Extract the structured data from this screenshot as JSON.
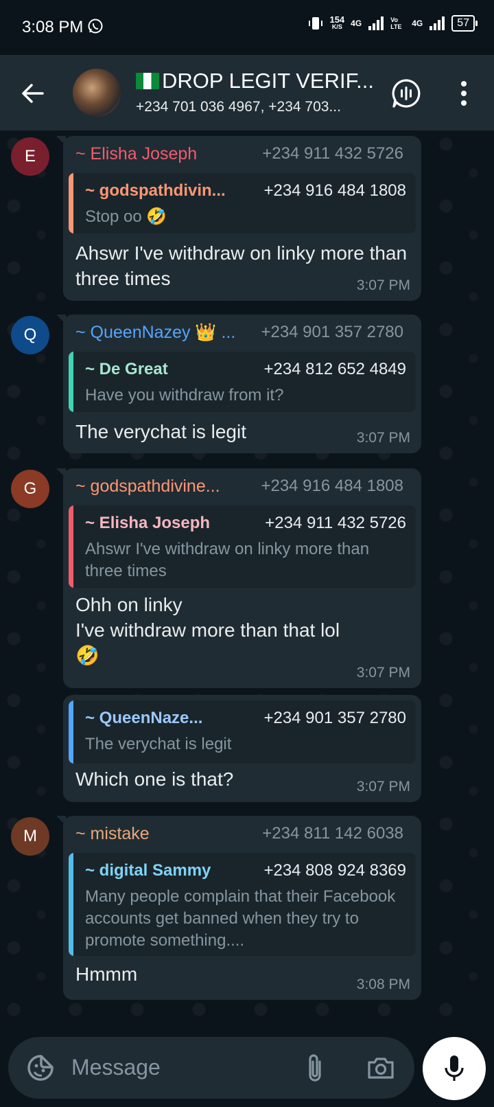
{
  "status_bar": {
    "time": "3:08 PM",
    "speed_value": "154",
    "speed_unit": "K/S",
    "net1": "4G",
    "volte": "Vo LTE",
    "net2": "4G",
    "battery": "57"
  },
  "header": {
    "title": "DROP LEGIT VERIF...",
    "subtitle": "+234 701 036 4967, +234 703..."
  },
  "messages": [
    {
      "avatar_letter": "E",
      "sender": "~ Elisha Joseph",
      "phone": "+234 911 432 5726",
      "quote_name": "~ godspathdivin...",
      "quote_phone": "+234 916 484 1808",
      "quote_text": "Stop oo 🤣",
      "text": "Ahswr I've withdraw on linky more than three times",
      "time": "3:07 PM"
    },
    {
      "avatar_letter": "Q",
      "sender": "~ QueenNazey 👑 ...",
      "phone": "+234 901 357 2780",
      "quote_name": "~ De Great",
      "quote_phone": "+234 812 652 4849",
      "quote_text": "Have you withdraw from it?",
      "text": "The verychat is legit",
      "time": "3:07 PM"
    },
    {
      "avatar_letter": "G",
      "sender": "~ godspathdivine...",
      "phone": "+234 916 484 1808",
      "quote_name": "~ Elisha Joseph",
      "quote_phone": "+234 911 432 5726",
      "quote_text": "Ahswr I've withdraw on linky more than three times",
      "text_line1": "Ohh on linky",
      "text_line2": "I've withdraw more than that lol",
      "text_emoji": "🤣",
      "time": "3:07 PM"
    },
    {
      "quote_name": "~ QueenNaze...",
      "quote_phone": "+234 901 357 2780",
      "quote_text": "The verychat is legit",
      "text": "Which one is that?",
      "time": "3:07 PM"
    },
    {
      "avatar_letter": "M",
      "sender": "~ mistake",
      "phone": "+234 811 142 6038",
      "quote_name": "~ digital Sammy",
      "quote_phone": "+234 808 924 8369",
      "quote_text": "Many people complain that their Facebook accounts get banned when they try to promote something....",
      "text": "Hmmm",
      "time": "3:08 PM"
    }
  ],
  "input": {
    "placeholder": "Message"
  },
  "colors": {
    "elisha": "#f15c6d",
    "queen": "#53a6fd",
    "godspath": "#fc9775",
    "mistake": "#e8a87c",
    "degreat_quote": "#3fd4b2",
    "digital_quote": "#53bdeb"
  }
}
